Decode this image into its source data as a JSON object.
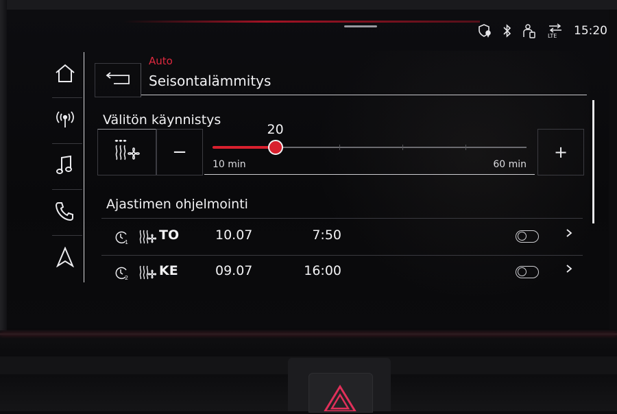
{
  "status_bar": {
    "time": "15:20",
    "icons": [
      "shield-location-icon",
      "bluetooth-icon",
      "person-phone-icon",
      "lte-icon"
    ],
    "lte_label": "LTE"
  },
  "sidebar": {
    "items": [
      {
        "name": "home",
        "icon": "home-icon"
      },
      {
        "name": "radio",
        "icon": "radio-antenna-icon"
      },
      {
        "name": "media",
        "icon": "music-note-icon"
      },
      {
        "name": "phone",
        "icon": "phone-icon"
      },
      {
        "name": "navigation",
        "icon": "navigation-arrow-icon"
      }
    ]
  },
  "header": {
    "breadcrumb": "Auto",
    "title": "Seisontalämmitys",
    "back_icon": "back-arrow-icon"
  },
  "instant_start": {
    "title": "Välitön käynnistys",
    "mode_icon": "heater-fan-icon",
    "minus_label": "−",
    "plus_label": "+",
    "slider": {
      "value": "20",
      "value_num": 20,
      "min_label": "10 min",
      "max_label": "60 min",
      "min": 10,
      "max": 60
    }
  },
  "timer_programming": {
    "title": "Ajastimen ohjelmointi",
    "timers": [
      {
        "index_label": "1",
        "day": "TO",
        "date": "10.07",
        "time": "7:50",
        "enabled": false
      },
      {
        "index_label": "2",
        "day": "KE",
        "date": "09.07",
        "time": "16:00",
        "enabled": false
      }
    ]
  },
  "colors": {
    "accent": "#d8202e",
    "text": "#f2f2f4",
    "background": "#0c0c0e"
  }
}
